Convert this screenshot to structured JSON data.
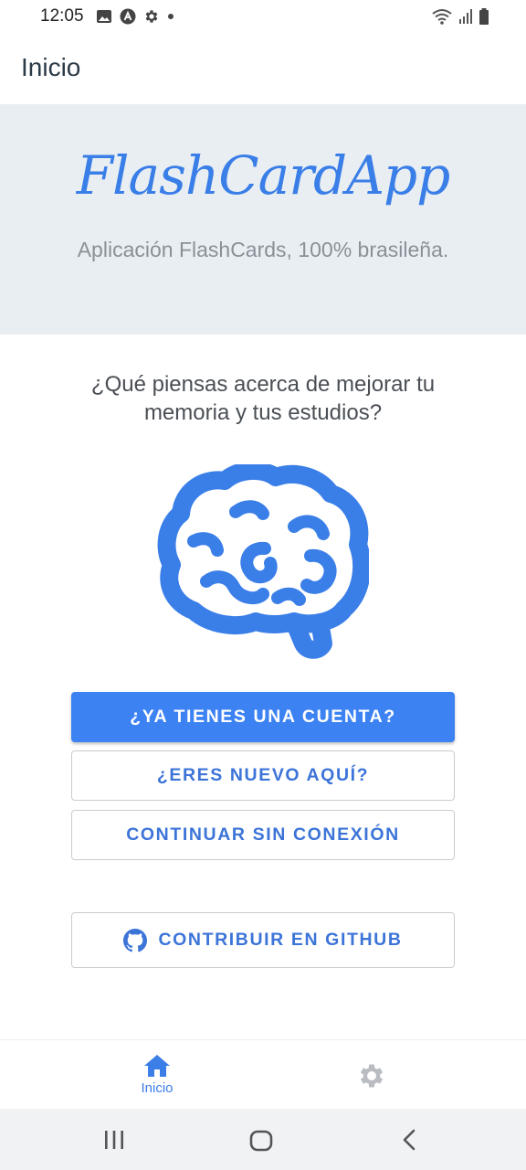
{
  "status_bar": {
    "time": "12:05",
    "left_icons": [
      "image-icon",
      "app-icon",
      "gear-icon",
      "dot-icon"
    ],
    "right_icons": [
      "wifi-icon",
      "signal-icon",
      "battery-icon"
    ]
  },
  "header": {
    "title": "Inicio"
  },
  "hero": {
    "title": "FlashCardApp",
    "subtitle": "Aplicación FlashCards, 100% brasileña."
  },
  "main": {
    "question": "¿Qué piensas acerca de mejorar tu memoria y tus estudios?",
    "illustration_icon": "brain-icon"
  },
  "buttons": {
    "login": "¿YA TIENES UNA CUENTA?",
    "register": "¿ERES NUEVO AQUÍ?",
    "offline": "CONTINUAR SIN CONEXIÓN",
    "github": "CONTRIBUIR EN GITHUB"
  },
  "tabbar": {
    "home_label": "Inicio",
    "home_icon": "home-icon",
    "settings_icon": "gear-icon"
  },
  "colors": {
    "accent": "#3c82f2",
    "hero_bg": "#e9eef2",
    "text": "#4a4f55"
  }
}
